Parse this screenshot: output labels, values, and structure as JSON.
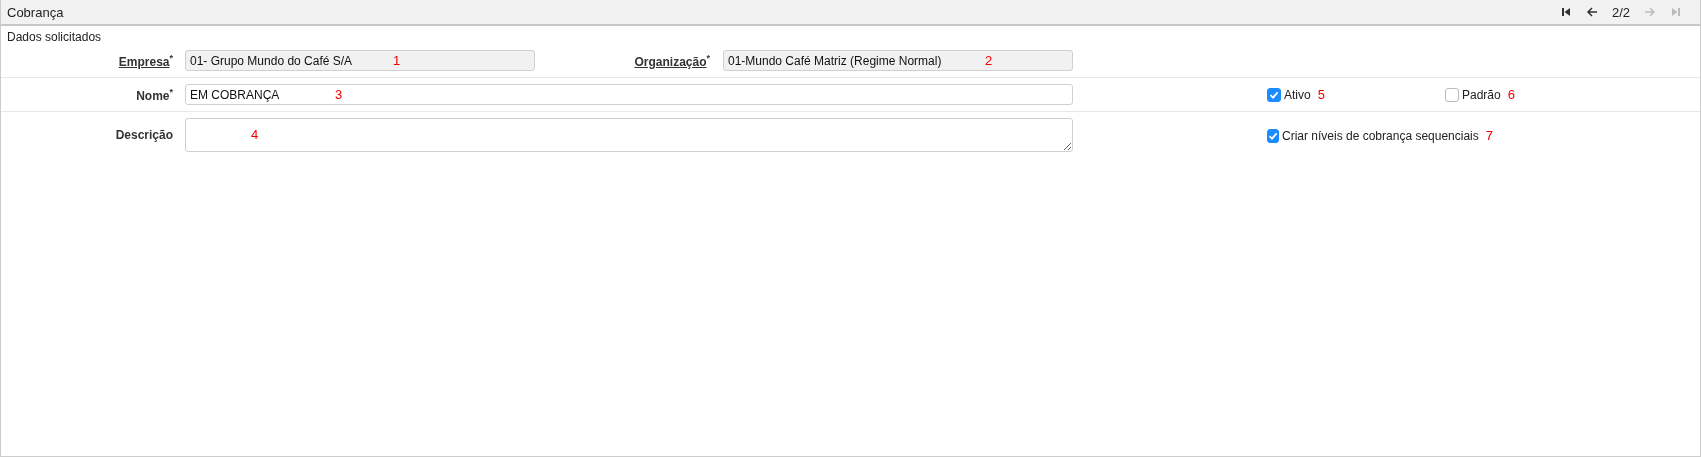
{
  "window": {
    "title": "Cobrança"
  },
  "pager": {
    "position": "2/2",
    "first_disabled": false,
    "prev_disabled": false,
    "next_disabled": true,
    "last_disabled": true
  },
  "section": {
    "title": "Dados solicitados"
  },
  "fields": [
    {
      "kind": "readonly",
      "label": "Empresa",
      "required_mark": "*",
      "underlined": true,
      "value": "01- Grupo Mundo do Café S/A",
      "marker": "1"
    },
    {
      "kind": "readonly",
      "label": "Organização",
      "required_mark": "*",
      "underlined": true,
      "value": "01-Mundo Café Matriz (Regime Normal)",
      "marker": "2"
    },
    {
      "kind": "text",
      "label": "Nome",
      "required_mark": "*",
      "underlined": false,
      "value": "EM COBRANÇA",
      "marker": "3"
    },
    {
      "kind": "textarea",
      "label": "Descrição",
      "underlined": false,
      "marker": "4"
    }
  ],
  "checkboxes": [
    {
      "label": "Ativo",
      "checked": true,
      "marker": "5"
    },
    {
      "label": "Padrão",
      "checked": false,
      "marker": "6"
    },
    {
      "label": "Criar níveis de cobrança sequenciais",
      "checked": true,
      "marker": "7"
    }
  ]
}
